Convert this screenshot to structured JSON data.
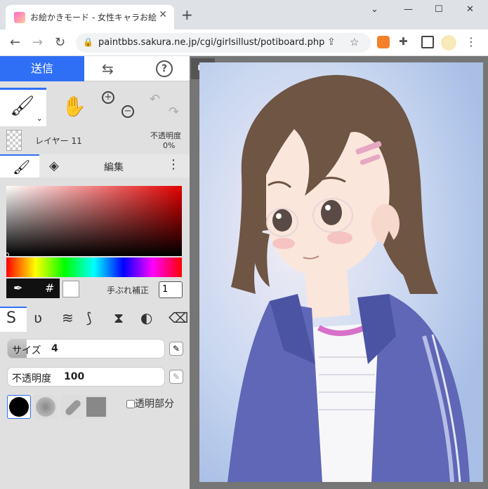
{
  "browser": {
    "tab_title": "お絵かきモード - 女性キャラお絵かき掲示板",
    "url": "paintbbs.sakura.ne.jp/cgi/girlsillust/potiboard.php"
  },
  "app": {
    "send_label": "送信",
    "layer_name": "レイヤー 11",
    "opacity_label": "不透明度",
    "opacity_value": "0%",
    "tab_edit_label": "編集",
    "stabilizer_label": "手ぶれ補正",
    "stabilizer_value": "1",
    "size_label": "サイズ",
    "size_value": "4",
    "size_fraction": 0.12,
    "opacity_slider_label": "不透明度",
    "opacity_slider_value": "100",
    "transparent_label": "透明部分",
    "hash_label": "#"
  },
  "colors": {
    "accent": "#2f6ff5",
    "canvas_bg": "#b7c9ea"
  }
}
